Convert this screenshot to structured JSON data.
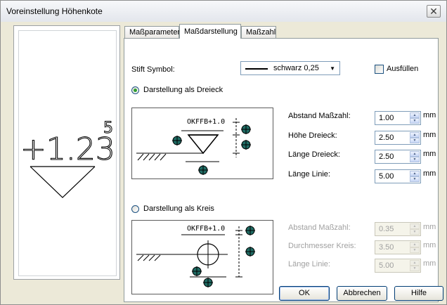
{
  "window": {
    "title": "Voreinstellung Höhenkote",
    "close_glyph": "✕"
  },
  "preview": {
    "value_text": "+1.23",
    "superscript": "5"
  },
  "tabs": [
    {
      "label": "Maßparameter",
      "active": false
    },
    {
      "label": "Maßdarstellung",
      "active": true
    },
    {
      "label": "Maßzahl",
      "active": false
    }
  ],
  "stift": {
    "label": "Stift Symbol:",
    "value": "schwarz 0,25",
    "arrow": "▼"
  },
  "fill": {
    "label": "Ausfüllen",
    "checked": false
  },
  "triangle": {
    "radio_label": "Darstellung als Dreieck",
    "selected": true,
    "diagram_text": "OKFFB+1.0",
    "fields": [
      {
        "label": "Abstand Maßzahl:",
        "value": "1.00",
        "unit": "mm"
      },
      {
        "label": "Höhe Dreieck:",
        "value": "2.50",
        "unit": "mm"
      },
      {
        "label": "Länge Dreieck:",
        "value": "2.50",
        "unit": "mm"
      },
      {
        "label": "Länge Linie:",
        "value": "5.00",
        "unit": "mm"
      }
    ]
  },
  "circle": {
    "radio_label": "Darstellung als Kreis",
    "selected": false,
    "diagram_text": "OKFFB+1.0",
    "fields": [
      {
        "label": "Abstand Maßzahl:",
        "value": "0.35",
        "unit": "mm"
      },
      {
        "label": "Durchmesser Kreis:",
        "value": "3.50",
        "unit": "mm"
      },
      {
        "label": "Länge Linie:",
        "value": "5.00",
        "unit": "mm"
      }
    ]
  },
  "buttons": {
    "ok": "OK",
    "cancel": "Abbrechen",
    "help": "Hilfe"
  },
  "colors": {
    "marker_fill": "#1f6b63",
    "radio_dot": "#2f9e2f"
  }
}
